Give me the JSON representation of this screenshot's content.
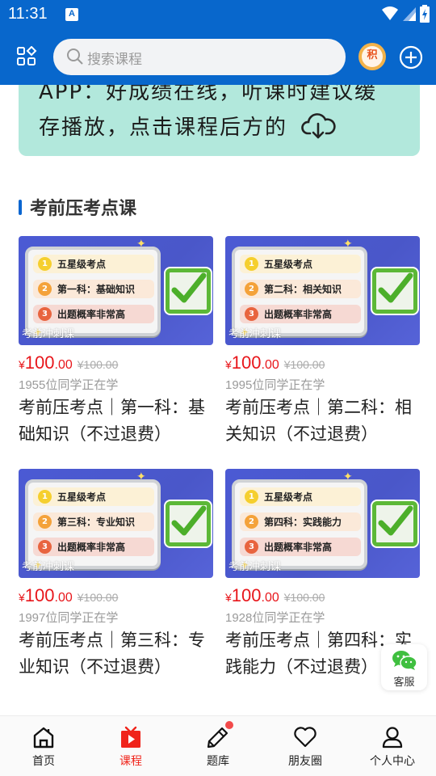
{
  "status_bar": {
    "time": "11:31",
    "notification_icon": "a-icon",
    "icons": [
      "wifi-icon",
      "signal-icon",
      "battery-charging-icon"
    ]
  },
  "header": {
    "apps_icon": "apps-grid-icon",
    "search_placeholder": "搜索课程",
    "points_badge": "积",
    "add_icon": "plus-circle-icon"
  },
  "banner": {
    "line1": "APP：好成绩在线，听课时建议缓",
    "line2": "存播放，点击课程后方的",
    "icon": "cloud-download-icon",
    "background": "#b2e8dc"
  },
  "section": {
    "title": "考前压考点课"
  },
  "courses": [
    {
      "thumb": {
        "row1": "五星级考点",
        "row2": "第一科：基础知识",
        "row3": "出题概率非常高",
        "tag": "考前冲刺课"
      },
      "price_symbol": "¥",
      "price_int": "100",
      "price_dec": ".00",
      "original_price": "¥100.00",
      "learners": "1955位同学正在学",
      "title": "考前压考点｜第一科：基础知识（不过退费）"
    },
    {
      "thumb": {
        "row1": "五星级考点",
        "row2": "第二科：相关知识",
        "row3": "出题概率非常高",
        "tag": "考前冲刺课"
      },
      "price_symbol": "¥",
      "price_int": "100",
      "price_dec": ".00",
      "original_price": "¥100.00",
      "learners": "1995位同学正在学",
      "title": "考前压考点｜第二科：相关知识（不过退费）"
    },
    {
      "thumb": {
        "row1": "五星级考点",
        "row2": "第三科：专业知识",
        "row3": "出题概率非常高",
        "tag": "考前冲刺课"
      },
      "price_symbol": "¥",
      "price_int": "100",
      "price_dec": ".00",
      "original_price": "¥100.00",
      "learners": "1997位同学正在学",
      "title": "考前压考点｜第三科：专业知识（不过退费）"
    },
    {
      "thumb": {
        "row1": "五星级考点",
        "row2": "第四科：实践能力",
        "row3": "出题概率非常高",
        "tag": "考前冲刺课"
      },
      "price_symbol": "¥",
      "price_int": "100",
      "price_dec": ".00",
      "original_price": "¥100.00",
      "learners": "1928位同学正在学",
      "title": "考前压考点｜第四科：实践能力（不过退费）"
    }
  ],
  "customer_service": {
    "label": "客服",
    "icon": "wechat-icon"
  },
  "tabbar": {
    "items": [
      {
        "label": "首页",
        "icon": "home-icon",
        "active": false
      },
      {
        "label": "课程",
        "icon": "tv-play-icon",
        "active": true
      },
      {
        "label": "题库",
        "icon": "pencil-icon",
        "active": false,
        "badge_dot": true
      },
      {
        "label": "朋友圈",
        "icon": "heart-icon",
        "active": false
      },
      {
        "label": "个人中心",
        "icon": "user-icon",
        "active": false
      }
    ],
    "active_color": "#f0241b"
  },
  "colors": {
    "brand_blue": "#0867cc",
    "price_red": "#e8161b"
  }
}
